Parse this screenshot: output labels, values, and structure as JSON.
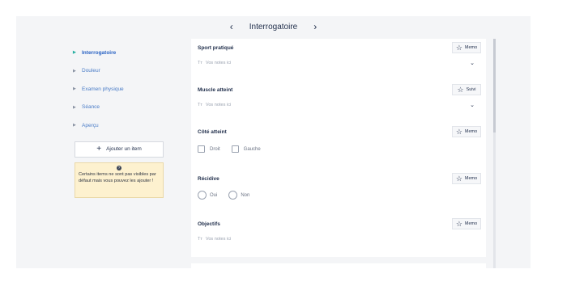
{
  "topnav": {
    "prev_icon": "chevron-left-icon",
    "title": "Interrogatoire",
    "next_icon": "chevron-right-icon"
  },
  "sidebar": {
    "items": [
      {
        "label": "Interrogatoire",
        "active": true
      },
      {
        "label": "Douleur",
        "active": false
      },
      {
        "label": "Examen physique",
        "active": false
      },
      {
        "label": "Séance",
        "active": false
      },
      {
        "label": "Aperçu",
        "active": false
      }
    ],
    "add_button": {
      "icon": "plus-icon",
      "label": "Ajouter un item"
    },
    "note": {
      "icon": "info-icon",
      "text": "Certains items ne sont pas visibles par défaut mais vous pouvez les ajouter !"
    }
  },
  "sections": [
    {
      "title": "Sport pratiqué",
      "badge": "Memo",
      "placeholder": "Vos notes ici",
      "notes_icon": "Tт"
    },
    {
      "title": "Muscle atteint",
      "badge": "Suivi",
      "placeholder": "Vos notes ici",
      "notes_icon": "Tт"
    },
    {
      "title": "Côté atteint",
      "badge": "Memo",
      "options": [
        "Droit",
        "Gauche"
      ]
    },
    {
      "title": "Récidive",
      "badge": "Memo",
      "options": [
        "Oui",
        "Non"
      ]
    },
    {
      "title": "Objectifs",
      "badge": "Memo",
      "placeholder": "Vos notes ici",
      "notes_icon": "Tт"
    }
  ],
  "colors": {
    "accent": "#2a63c4",
    "note_bg": "#fdf1cf",
    "app_bg": "#f4f5f7"
  }
}
